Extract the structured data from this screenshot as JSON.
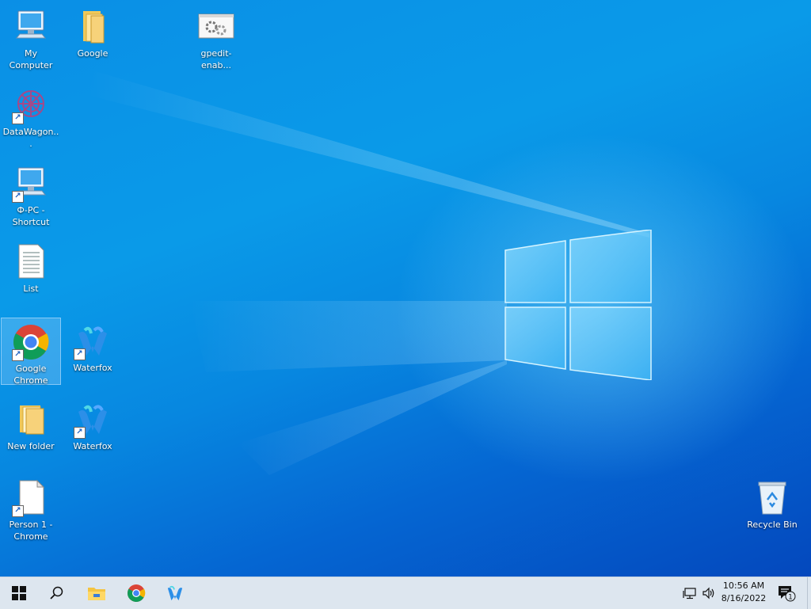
{
  "desktop": {
    "icons": [
      {
        "label": "My Computer"
      },
      {
        "label": "Google"
      },
      {
        "label": "gpedit-enab..."
      },
      {
        "label": "DataWagon..."
      },
      {
        "label": "Ф-PC - Shortcut"
      },
      {
        "label": "List"
      },
      {
        "label": "Google Chrome"
      },
      {
        "label": "Waterfox"
      },
      {
        "label": "New folder"
      },
      {
        "label": "Waterfox"
      },
      {
        "label": "Person 1 - Chrome"
      },
      {
        "label": "Recycle Bin"
      }
    ]
  },
  "taskbar": {
    "pinned": [
      {
        "icon": "windows-start-icon"
      },
      {
        "icon": "search-icon"
      },
      {
        "icon": "file-explorer-icon"
      },
      {
        "icon": "chrome-icon"
      },
      {
        "icon": "waterfox-icon"
      }
    ],
    "tray": {
      "network_icon": "network-icon",
      "volume_icon": "volume-icon",
      "time": "10:56 AM",
      "date": "8/16/2022",
      "notification_count": "1"
    }
  },
  "colors": {
    "wallpaper_primary": "#0a8fe6",
    "wallpaper_dark": "#0448bd",
    "taskbar_bg": "#dde6ef",
    "selection": "#b4dcff"
  }
}
